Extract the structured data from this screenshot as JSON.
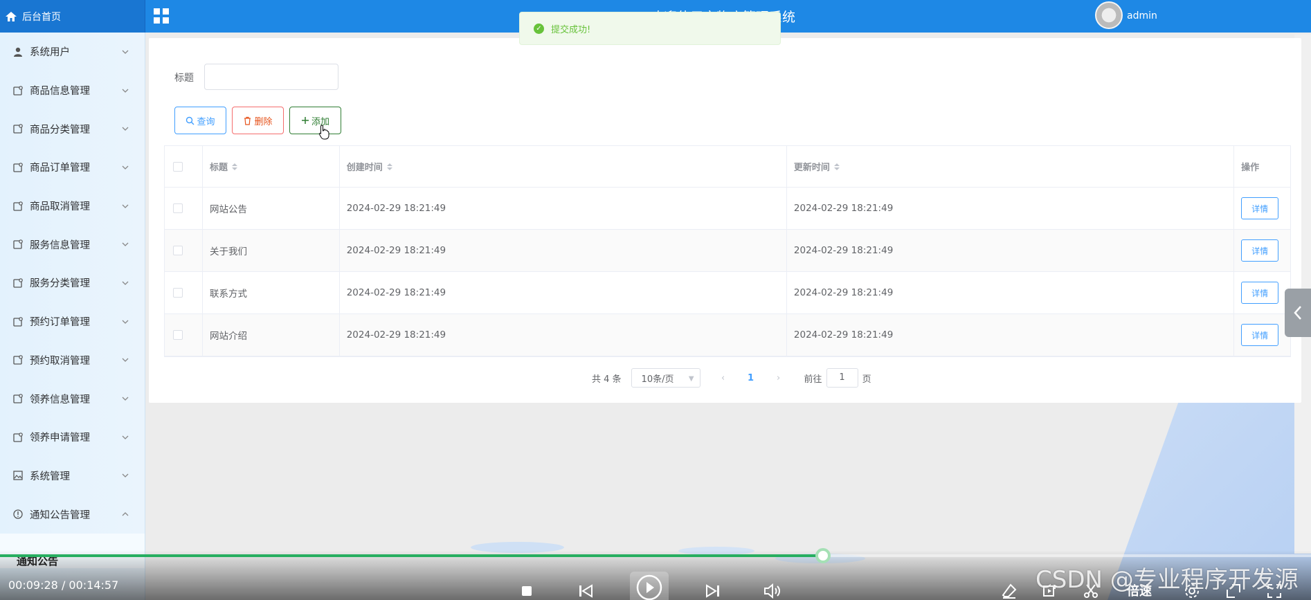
{
  "header": {
    "brand": "后台首页",
    "title": "欢迎使用宠物店管理系统",
    "user": "admin"
  },
  "toast": {
    "message": "提交成功!"
  },
  "sidebar": {
    "items": [
      {
        "label": "系统用户",
        "icon": "user-icon"
      },
      {
        "label": "商品信息管理",
        "icon": "doc-icon"
      },
      {
        "label": "商品分类管理",
        "icon": "doc-icon"
      },
      {
        "label": "商品订单管理",
        "icon": "doc-icon"
      },
      {
        "label": "商品取消管理",
        "icon": "doc-icon"
      },
      {
        "label": "服务信息管理",
        "icon": "doc-icon"
      },
      {
        "label": "服务分类管理",
        "icon": "doc-icon"
      },
      {
        "label": "预约订单管理",
        "icon": "doc-icon"
      },
      {
        "label": "预约取消管理",
        "icon": "doc-icon"
      },
      {
        "label": "领养信息管理",
        "icon": "doc-icon"
      },
      {
        "label": "领养申请管理",
        "icon": "doc-icon"
      },
      {
        "label": "系统管理",
        "icon": "image-icon"
      },
      {
        "label": "通知公告管理",
        "icon": "info-icon",
        "expanded": true
      }
    ],
    "submenu_active": "通知公告"
  },
  "filter": {
    "label": "标题",
    "value": ""
  },
  "actions": {
    "query": "查询",
    "delete": "删除",
    "add": "添加"
  },
  "table": {
    "columns": [
      "标题",
      "创建时间",
      "更新时间",
      "操作"
    ],
    "rows": [
      {
        "title": "网站公告",
        "created": "2024-02-29 18:21:49",
        "updated": "2024-02-29 18:21:49",
        "action": "详情"
      },
      {
        "title": "关于我们",
        "created": "2024-02-29 18:21:49",
        "updated": "2024-02-29 18:21:49",
        "action": "详情"
      },
      {
        "title": "联系方式",
        "created": "2024-02-29 18:21:49",
        "updated": "2024-02-29 18:21:49",
        "action": "详情"
      },
      {
        "title": "网站介绍",
        "created": "2024-02-29 18:21:49",
        "updated": "2024-02-29 18:21:49",
        "action": "详情"
      }
    ]
  },
  "pagination": {
    "total": "共 4 条",
    "page_size": "10条/页",
    "current": "1",
    "goto_label": "前往",
    "goto_value": "1",
    "goto_suffix": "页"
  },
  "player": {
    "time": "00:09:28 / 00:14:57",
    "progress": 0.628,
    "speed_label": "倍速",
    "watermark": "CSDN @专业程序开发源"
  },
  "colors": {
    "header": "#1e88e5",
    "primary": "#409eff",
    "danger": "#f56c6c",
    "success": "#2e7d32",
    "progress": "#27ae60"
  }
}
